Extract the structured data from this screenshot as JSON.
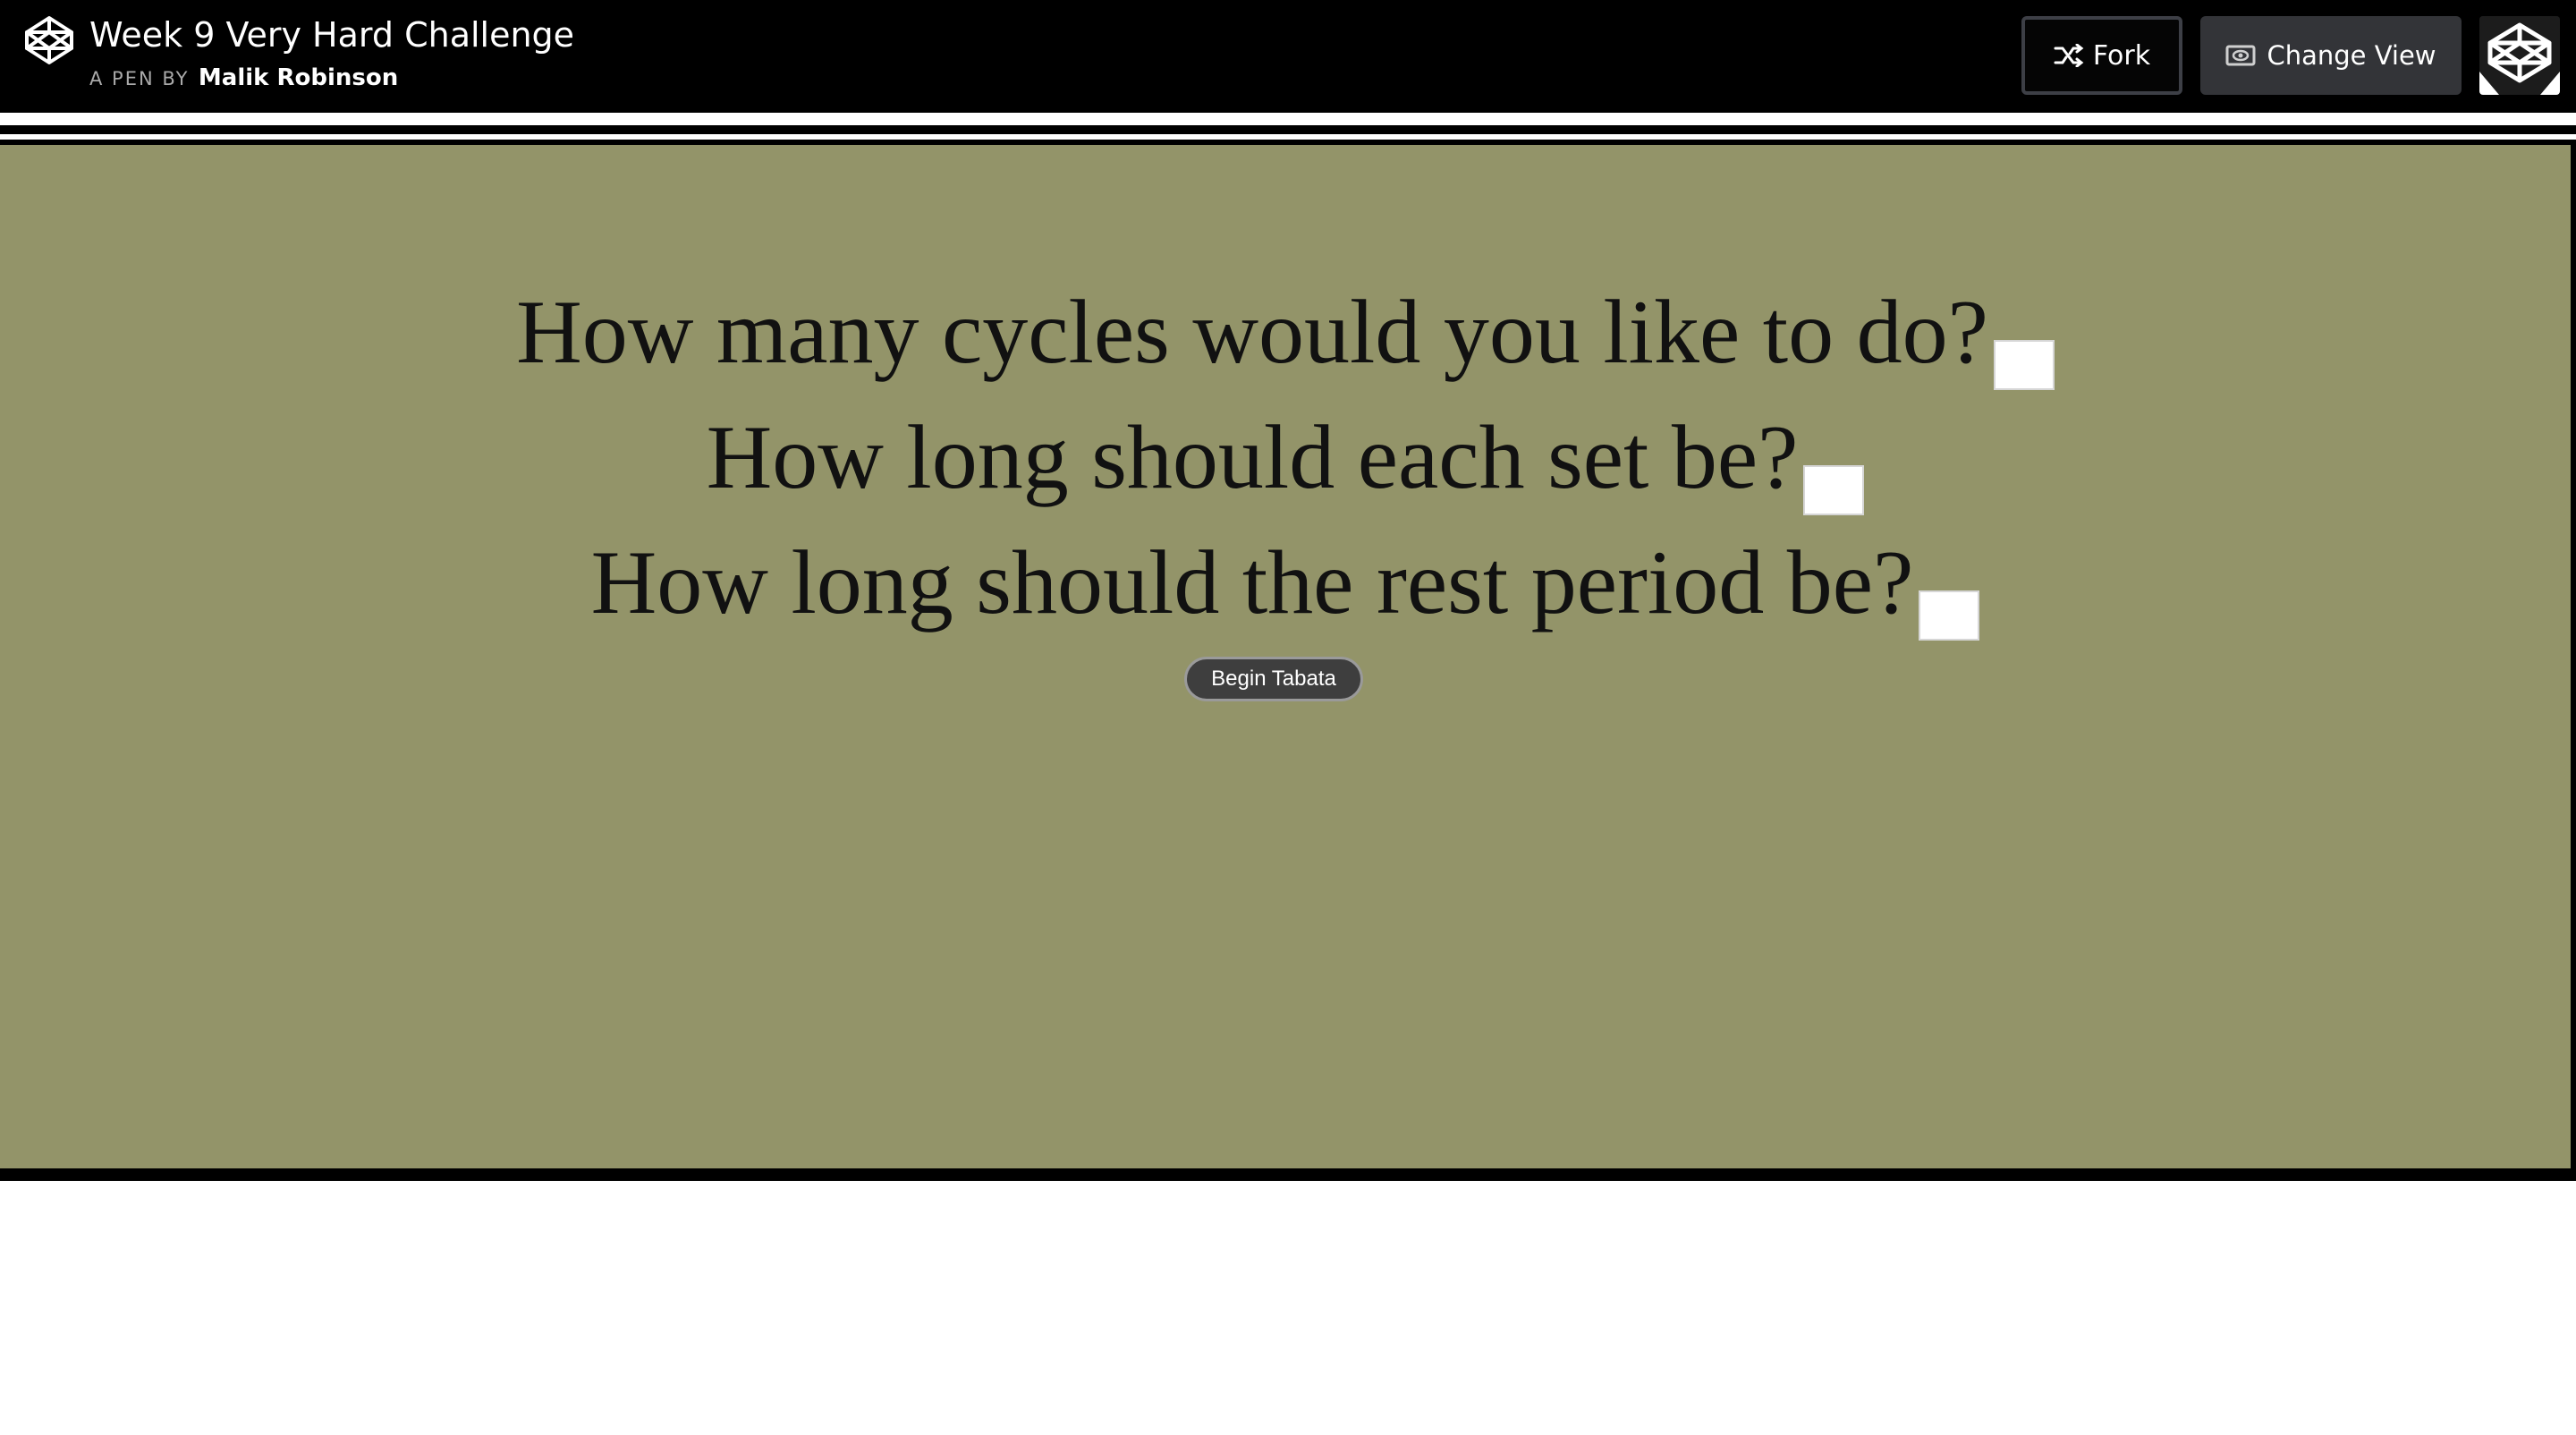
{
  "header": {
    "title": "Week 9 Very Hard Challenge",
    "byline_label": "A PEN BY",
    "author": "Malik Robinson",
    "fork_label": "Fork",
    "change_view_label": "Change View",
    "icons": {
      "logo": "codepen-logo-icon",
      "fork": "fork-icon",
      "change_view": "eye-icon",
      "avatar": "codepen-avatar"
    }
  },
  "preview": {
    "background": "#939469",
    "questions": [
      {
        "label": "How many cycles would you like to do?",
        "value": ""
      },
      {
        "label": "How long should each set be?",
        "value": ""
      },
      {
        "label": "How long should the rest period be?",
        "value": ""
      }
    ],
    "begin_button_label": "Begin Tabata"
  }
}
